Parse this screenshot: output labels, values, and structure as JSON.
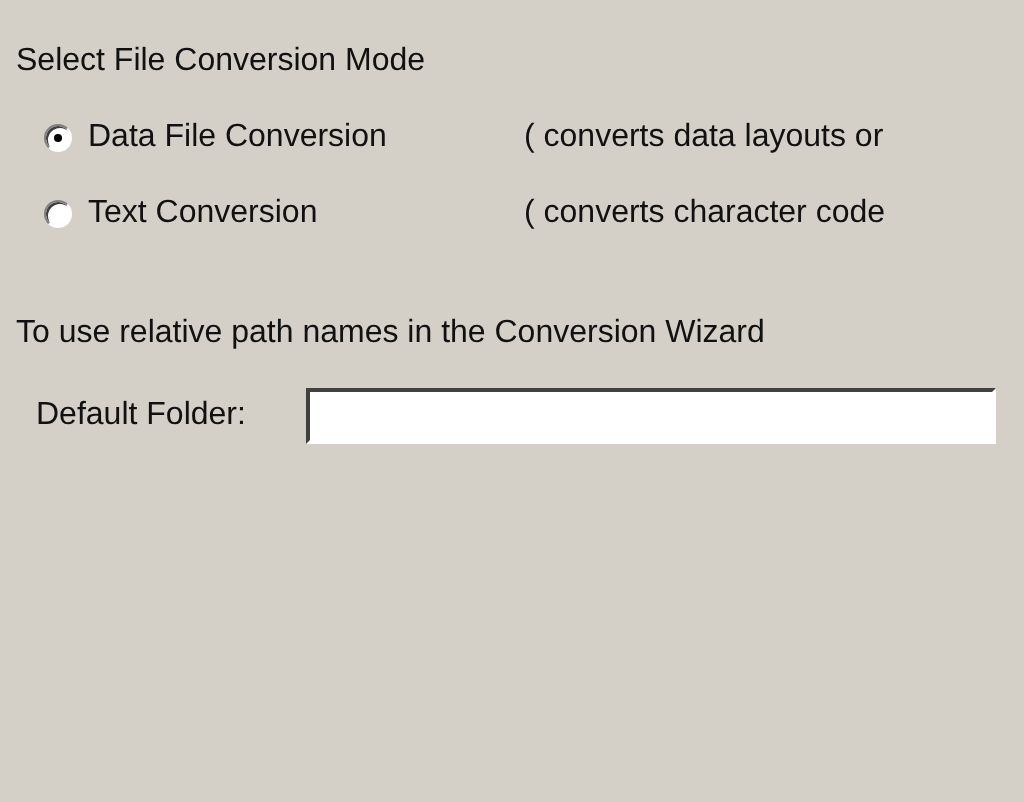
{
  "heading": "Select File Conversion Mode",
  "modes": [
    {
      "label": "Data File Conversion",
      "description": "( converts data layouts or",
      "selected": true
    },
    {
      "label": "Text Conversion",
      "description": "( converts character code",
      "selected": false
    }
  ],
  "note": "To use relative path names in the Conversion Wizard",
  "default_folder": {
    "label": "Default Folder:"
  }
}
